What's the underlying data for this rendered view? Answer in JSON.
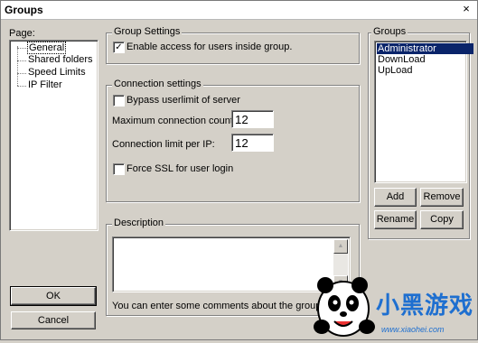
{
  "window": {
    "title": "Groups",
    "close_glyph": "×"
  },
  "page_panel": {
    "label": "Page:",
    "items": [
      "General",
      "Shared folders",
      "Speed Limits",
      "IP Filter"
    ]
  },
  "group_settings": {
    "legend": "Group Settings",
    "enable_access": {
      "label": "Enable access for users inside group.",
      "checked": true
    }
  },
  "connection_settings": {
    "legend": "Connection settings",
    "bypass": {
      "label": "Bypass userlimit of server",
      "checked": false
    },
    "max_conn_label": "Maximum connection count:",
    "max_conn_value": "12",
    "limit_per_ip_label": "Connection limit per IP:",
    "limit_per_ip_value": "12",
    "force_ssl": {
      "label": "Force SSL for user login",
      "checked": false
    }
  },
  "description": {
    "legend": "Description",
    "value": "",
    "hint": "You can enter some comments about the group"
  },
  "groups_panel": {
    "legend": "Groups",
    "items": [
      "Administrator",
      "DownLoad",
      "UpLoad"
    ],
    "selected_index": 0,
    "buttons": {
      "add": "Add",
      "remove": "Remove",
      "rename": "Rename",
      "copy": "Copy"
    }
  },
  "footer": {
    "ok": "OK",
    "cancel": "Cancel"
  },
  "watermark": {
    "text": "小黑游戏",
    "url_text": "www.xiaohei.com"
  },
  "colors": {
    "selection": "#0a246a",
    "face": "#d4d0c8",
    "watermark_blue": "#1e6fd0"
  }
}
